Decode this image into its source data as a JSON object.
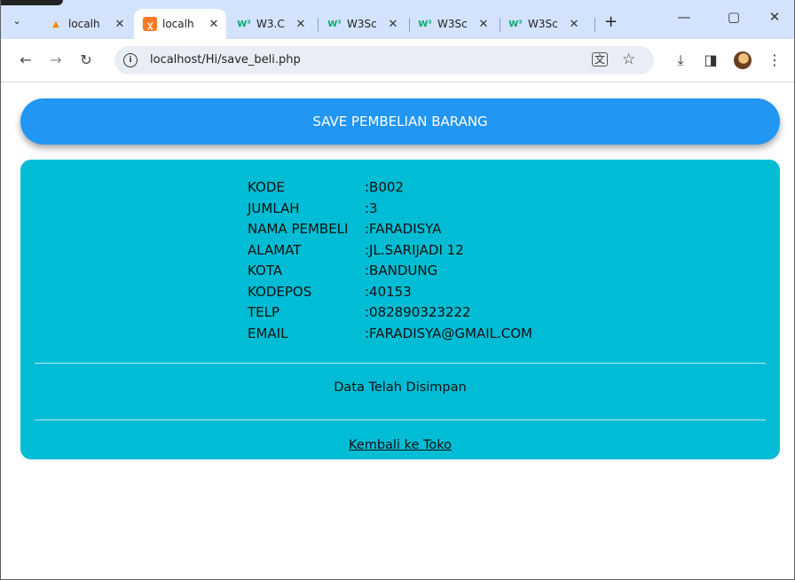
{
  "tabs": [
    {
      "label": "localh",
      "icon": "phpmyadmin-icon"
    },
    {
      "label": "localh",
      "icon": "xampp-icon"
    },
    {
      "label": "W3.C",
      "icon": "w3schools-icon"
    },
    {
      "label": "W3Sc",
      "icon": "w3schools-icon"
    },
    {
      "label": "W3Sc",
      "icon": "w3schools-icon"
    },
    {
      "label": "W3Sc",
      "icon": "w3schools-icon"
    }
  ],
  "active_tab": 1,
  "address_bar": {
    "url": "localhost/Hi/save_beli.php"
  },
  "page": {
    "header": "SAVE PEMBELIAN BARANG",
    "fields": [
      {
        "label": "KODE",
        "value": ":B002"
      },
      {
        "label": "JUMLAH",
        "value": ":3"
      },
      {
        "label": "NAMA PEMBELI",
        "value": ":FARADISYA"
      },
      {
        "label": "ALAMAT",
        "value": ":JL.SARIJADI 12"
      },
      {
        "label": "KOTA",
        "value": ":BANDUNG"
      },
      {
        "label": "KODEPOS",
        "value": ":40153"
      },
      {
        "label": "TELP",
        "value": ":082890323222"
      },
      {
        "label": "EMAIL",
        "value": ":FARADISYA@GMAIL.COM"
      }
    ],
    "message": "Data Telah Disimpan",
    "back_link": "Kembali ke Toko"
  },
  "colors": {
    "header_blue": "#2196f3",
    "panel_cyan": "#00bcd4",
    "tabstrip": "#d3e3fd"
  }
}
